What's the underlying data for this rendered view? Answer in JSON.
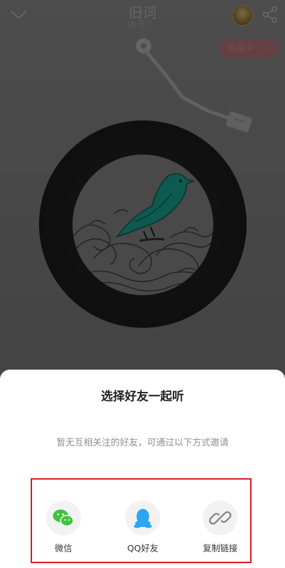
{
  "player": {
    "title": "旧词",
    "artist": "唐青 〉",
    "live_badge": "直播中",
    "live_close": "×"
  },
  "sheet": {
    "title": "选择好友一起听",
    "hint": "暂无互相关注的好友，可通过以下方式邀请",
    "options": [
      {
        "label": "微信",
        "icon": "wechat-icon",
        "color": "#3cc43a"
      },
      {
        "label": "QQ好友",
        "icon": "qq-icon",
        "color": "#2ba6f5"
      },
      {
        "label": "复制链接",
        "icon": "link-icon",
        "color": "#8a8a8a"
      }
    ]
  },
  "highlight_color": "#d61a20"
}
